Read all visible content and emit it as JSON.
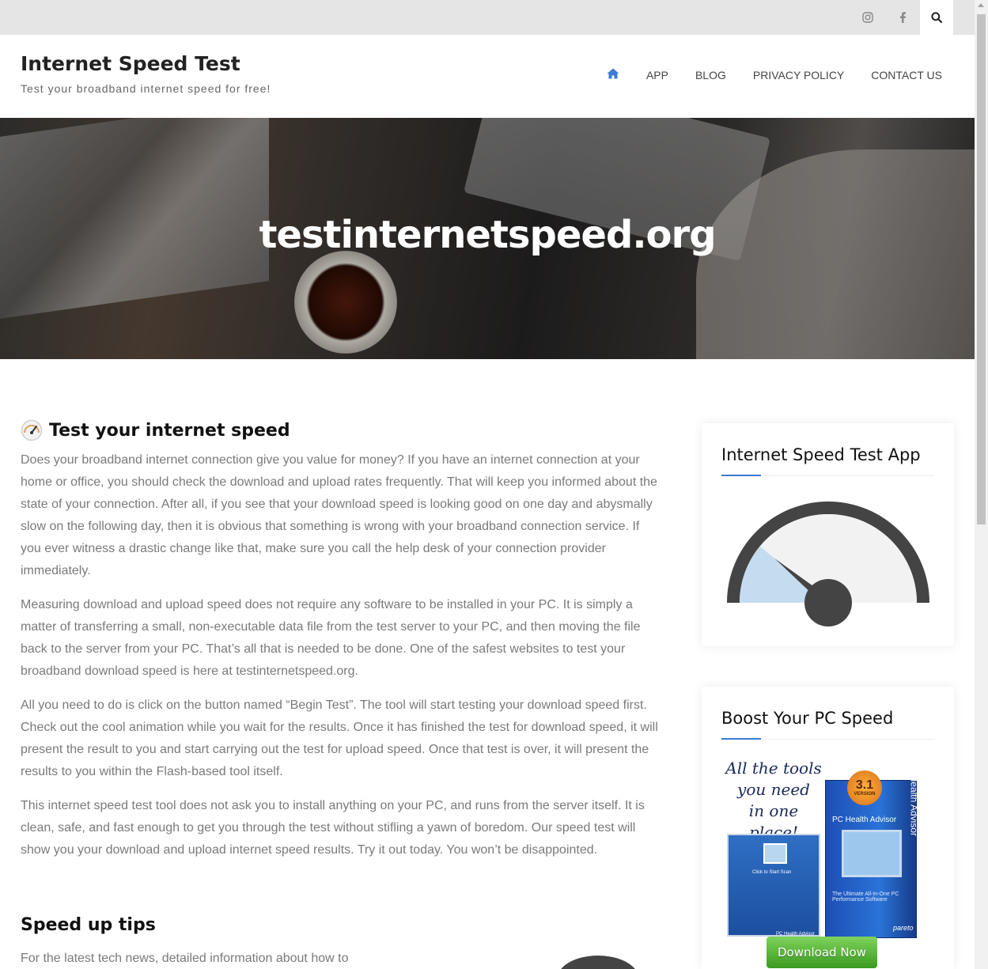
{
  "topbar": {
    "icons": [
      "instagram-icon",
      "facebook-icon",
      "search-icon"
    ]
  },
  "header": {
    "site_title": "Internet Speed Test",
    "tagline": "Test your broadband internet speed for free!",
    "nav": [
      "APP",
      "BLOG",
      "PRIVACY POLICY",
      "CONTACT US"
    ]
  },
  "hero": {
    "title": "testinternetspeed.org"
  },
  "main": {
    "section_title": "Test your internet speed",
    "paragraphs": [
      "Does your broadband internet connection give you value for money? If you have an internet connection at your home or office, you should check the download and upload rates frequently. That will keep you informed about the state of your connection. After all, if you see that your download speed is looking good on one day and abysmally slow on the following day, then it is obvious that something is wrong with your broadband connection service. If you ever witness a drastic change like that, make sure you call the help desk of your connection provider immediately.",
      "Measuring download and upload speed does not require any software to be installed in your PC. It is simply a matter of transferring a small, non-executable data file from the test server to your PC, and then moving the file back to the server from your PC. That’s all that is needed to be done. One of the safest websites to test your broadband download speed is here at testinternetspeed.org.",
      "All you need to do is click on the button named “Begin Test”. The tool will start testing your download speed first. Check out the cool animation while you wait for the results. Once it has finished the test for download speed, it will present the result to you and start carrying out the test for upload speed. Once that test is over, it will present the results to you within the Flash-based tool itself.",
      "This internet speed test tool does not ask you to install anything on your PC, and runs from the server itself. It is clean, safe, and fast enough to get you through the test without stifling a yawn of boredom. Our speed test will show you your download and upload internet speed results. Try it out today. You won’t be disappointed."
    ],
    "tips_title": "Speed up tips",
    "tips_text": "For the latest tech news, detailed information about how to"
  },
  "sidebar": {
    "app_widget_title": "Internet Speed Test App",
    "boost_widget_title": "Boost Your PC Speed",
    "promo": {
      "headline_1": "All the tools",
      "headline_2": "you need",
      "headline_3": "in one place!",
      "badge_number": "3.1",
      "badge_label": "VERSION",
      "box_title": "PC Health Advisor",
      "box_side": "PC Health Advisor",
      "box_foot": "The Ultimate All-In-One PC Performance Software",
      "app_label": "Click to Start Scan",
      "app_foot": "PC Health Advisor",
      "brand": "pareto",
      "download_label": "Download Now"
    }
  },
  "colors": {
    "accent": "#3a7bd5",
    "topbar_bg": "#e5e5e5",
    "gauge_dark": "#444444",
    "gauge_fill": "#c5dcf0"
  },
  "gauge_level": 0.22
}
